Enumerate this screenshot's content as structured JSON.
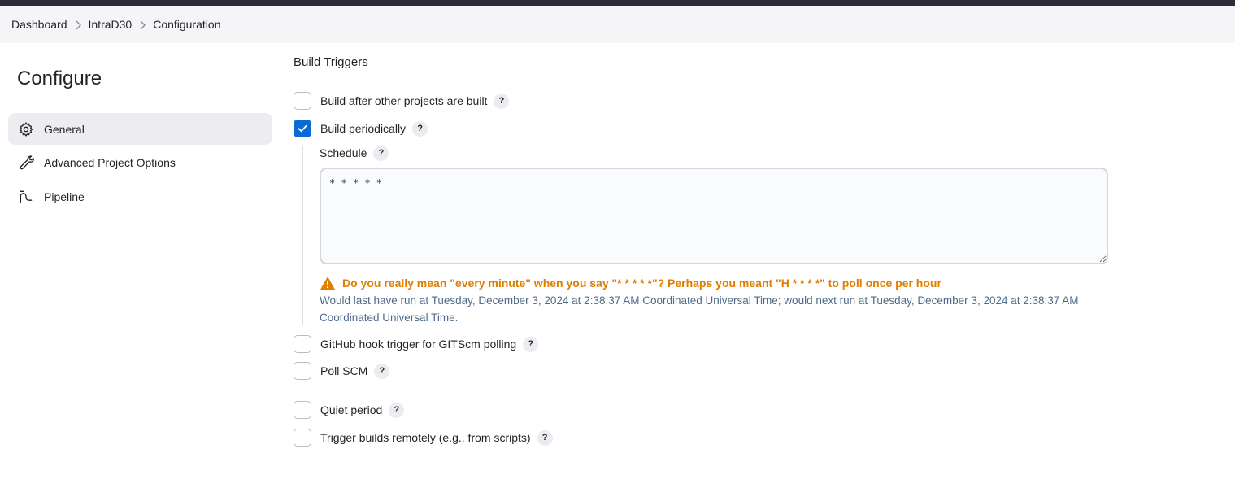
{
  "breadcrumb": [
    "Dashboard",
    "IntraD30",
    "Configuration"
  ],
  "sidebar": {
    "title": "Configure",
    "items": [
      {
        "label": "General",
        "icon": "gear-icon",
        "active": true
      },
      {
        "label": "Advanced Project Options",
        "icon": "wrench-icon",
        "active": false
      },
      {
        "label": "Pipeline",
        "icon": "pipeline-icon",
        "active": false
      }
    ]
  },
  "main": {
    "section_title": "Build Triggers",
    "triggers": {
      "after_other": {
        "label": "Build after other projects are built",
        "checked": false
      },
      "periodically": {
        "label": "Build periodically",
        "checked": true
      },
      "github_hook": {
        "label": "GitHub hook trigger for GITScm polling",
        "checked": false
      },
      "poll_scm": {
        "label": "Poll SCM",
        "checked": false
      },
      "quiet_period": {
        "label": "Quiet period",
        "checked": false
      },
      "remote": {
        "label": "Trigger builds remotely (e.g., from scripts)",
        "checked": false
      }
    },
    "help_label": "?",
    "schedule": {
      "label": "Schedule",
      "value": "* * * * *",
      "warning": "Do you really mean \"every minute\" when you say \"* * * * *\"? Perhaps you meant \"H * * * *\" to poll once per hour",
      "info": "Would last have run at Tuesday, December 3, 2024 at 2:38:37 AM Coordinated Universal Time; would next run at Tuesday, December 3, 2024 at 2:38:37 AM Coordinated Universal Time."
    }
  },
  "colors": {
    "accent": "#0b6bd6",
    "warning": "#e07e00",
    "info": "#4f6a8a",
    "topbar": "#2b2e3a"
  }
}
